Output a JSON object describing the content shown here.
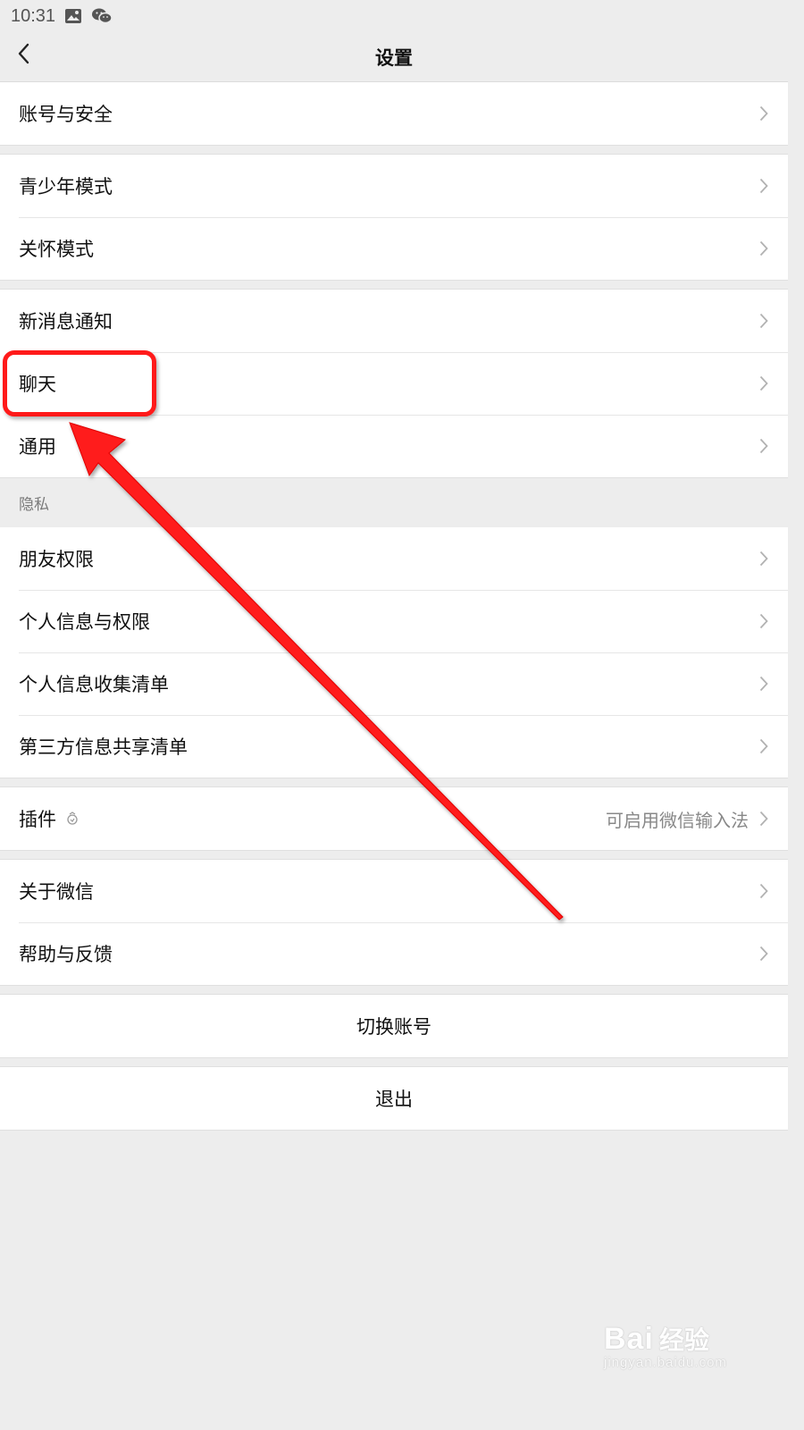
{
  "status_bar": {
    "time": "10:31"
  },
  "nav": {
    "title": "设置"
  },
  "groups": [
    {
      "items": [
        {
          "label": "账号与安全"
        }
      ]
    },
    {
      "items": [
        {
          "label": "青少年模式"
        },
        {
          "label": "关怀模式"
        }
      ]
    },
    {
      "items": [
        {
          "label": "新消息通知"
        },
        {
          "label": "聊天"
        },
        {
          "label": "通用"
        }
      ]
    }
  ],
  "privacy": {
    "header": "隐私",
    "items": [
      {
        "label": "朋友权限"
      },
      {
        "label": "个人信息与权限"
      },
      {
        "label": "个人信息收集清单"
      },
      {
        "label": "第三方信息共享清单"
      }
    ]
  },
  "plugins": {
    "label": "插件",
    "value": "可启用微信输入法"
  },
  "about": {
    "items": [
      {
        "label": "关于微信"
      },
      {
        "label": "帮助与反馈"
      }
    ]
  },
  "actions": {
    "switch_account": "切换账号",
    "logout": "退出"
  },
  "watermark": {
    "main": "Bai",
    "main2": "经验",
    "sub": "jingyan.baidu.com"
  },
  "colors": {
    "background": "#ededed",
    "annotation_red": "#ff1a1a"
  },
  "icons": [
    "back-arrow-icon",
    "chevron-right-icon",
    "plugin-icon",
    "gallery-icon",
    "wechat-icon"
  ]
}
